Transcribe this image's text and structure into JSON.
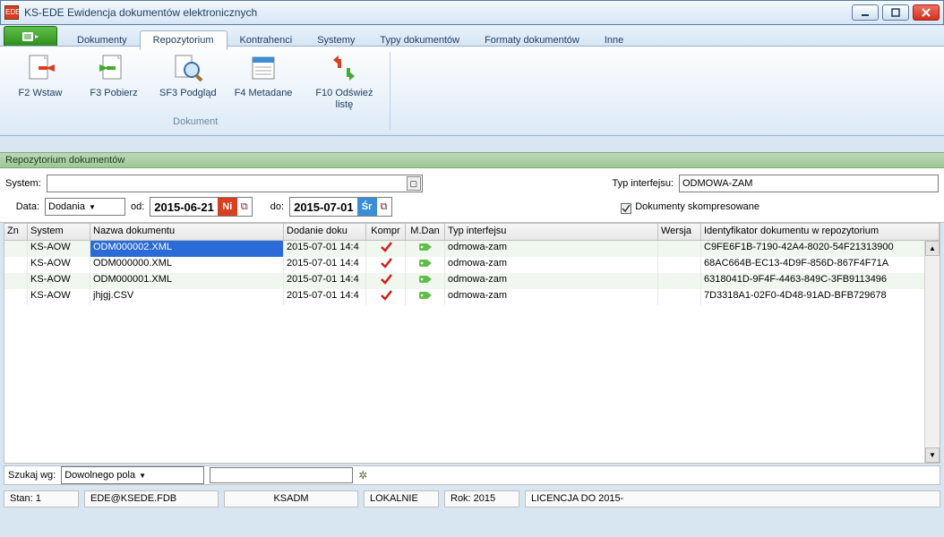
{
  "window": {
    "title": "KS-EDE Ewidencja dokumentów elektronicznych"
  },
  "tabs": [
    "Dokumenty",
    "Repozytorium",
    "Kontrahenci",
    "Systemy",
    "Typy dokumentów",
    "Formaty dokumentów",
    "Inne"
  ],
  "active_tab": 1,
  "ribbon": {
    "group_label": "Dokument",
    "buttons": [
      {
        "id": "f2-wstaw",
        "label": "F2 Wstaw"
      },
      {
        "id": "f3-pobierz",
        "label": "F3 Pobierz"
      },
      {
        "id": "sf3-podglad",
        "label": "SF3 Podgląd"
      },
      {
        "id": "f4-metadane",
        "label": "F4 Metadane"
      },
      {
        "id": "f10-odswiez",
        "label": "F10 Odśwież listę"
      }
    ]
  },
  "panel_title": "Repozytorium dokumentów",
  "filters": {
    "system_label": "System:",
    "system_value": "",
    "typ_label": "Typ interfejsu:",
    "typ_value": "ODMOWA-ZAM",
    "data_label": "Data:",
    "data_kind": "Dodania",
    "od_label": "od:",
    "od_value": "2015-06-21",
    "od_day": "Ni",
    "do_label": "do:",
    "do_value": "2015-07-01",
    "do_day": "Śr",
    "compressed_label": "Dokumenty skompresowane",
    "compressed_checked": true
  },
  "columns": [
    "Zn",
    "System",
    "Nazwa dokumentu",
    "Dodanie doku",
    "Kompr",
    "M.Dan",
    "Typ interfejsu",
    "Wersja",
    "Identyfikator dokumentu w repozytorium"
  ],
  "rows": [
    {
      "sys": "KS-AOW",
      "name": "ODM000002.XML",
      "date": "2015-07-01 14:4",
      "typ": "odmowa-zam",
      "id": "C9FE6F1B-7190-42A4-8020-54F21313900",
      "sel": true,
      "alt": true
    },
    {
      "sys": "KS-AOW",
      "name": "ODM000000.XML",
      "date": "2015-07-01 14:4",
      "typ": "odmowa-zam",
      "id": "68AC664B-EC13-4D9F-856D-867F4F71A"
    },
    {
      "sys": "KS-AOW",
      "name": "ODM000001.XML",
      "date": "2015-07-01 14:4",
      "typ": "odmowa-zam",
      "id": "6318041D-9F4F-4463-849C-3FB9113496",
      "alt": true
    },
    {
      "sys": "KS-AOW",
      "name": "jhjgj.CSV",
      "date": "2015-07-01 14:4",
      "typ": "odmowa-zam",
      "id": "7D3318A1-02F0-4D48-91AD-BFB729678"
    }
  ],
  "search": {
    "label": "Szukaj wg:",
    "mode": "Dowolnego pola",
    "value": ""
  },
  "status": {
    "stan": "Stan: 1",
    "db": "EDE@KSEDE.FDB",
    "user": "KSADM",
    "loc": "LOKALNIE",
    "rok": "Rok: 2015",
    "lic": "LICENCJA DO 2015-"
  }
}
